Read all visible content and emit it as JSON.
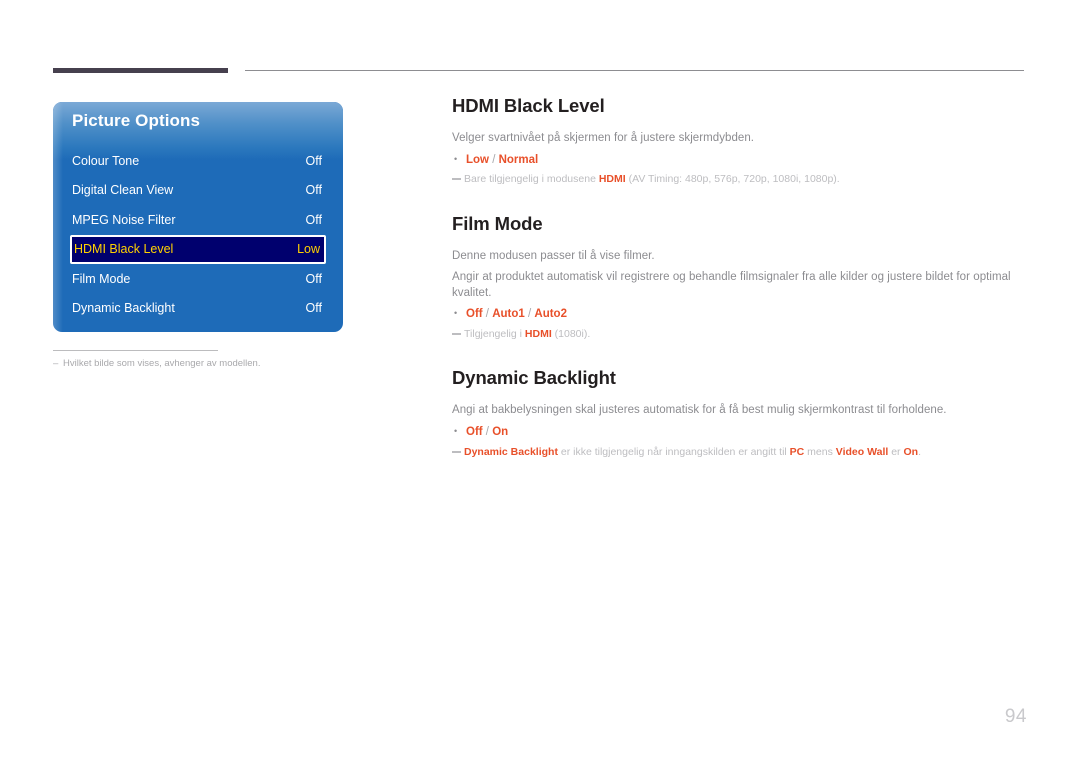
{
  "page": {
    "number": "94",
    "figure_note": "Hvilket bilde som vises, avhenger av modellen.",
    "figure_note_dash": "–"
  },
  "osd": {
    "title": "Picture Options",
    "rows": [
      {
        "label": "Colour Tone",
        "value": "Off",
        "selected": false
      },
      {
        "label": "Digital Clean View",
        "value": "Off",
        "selected": false
      },
      {
        "label": "MPEG Noise Filter",
        "value": "Off",
        "selected": false
      },
      {
        "label": "HDMI Black Level",
        "value": "Low",
        "selected": true
      },
      {
        "label": "Film Mode",
        "value": "Off",
        "selected": false
      },
      {
        "label": "Dynamic Backlight",
        "value": "Off",
        "selected": false
      }
    ],
    "colors": {
      "panel_blue": "#1e6bb8",
      "selected_bg": "#00006e",
      "selected_text": "#ffd200"
    }
  },
  "sections": {
    "hdmi_black_level": {
      "heading": "HDMI Black Level",
      "paragraph": "Velger svartnivået på skjermen for å justere skjermdybden.",
      "options": {
        "a": "Low",
        "sep1": " / ",
        "b": "Normal"
      },
      "note": {
        "pre": "Bare tilgjengelig i modusene ",
        "hl": "HDMI",
        "post": " (AV Timing: 480p, 576p, 720p, 1080i, 1080p)."
      }
    },
    "film_mode": {
      "heading": "Film Mode",
      "paragraph1": "Denne modusen passer til å vise filmer.",
      "paragraph2": "Angir at produktet automatisk vil registrere og behandle filmsignaler fra alle kilder og justere bildet for optimal kvalitet.",
      "options": {
        "a": "Off",
        "sep1": " / ",
        "b": "Auto1",
        "sep2": " / ",
        "c": "Auto2"
      },
      "note": {
        "pre": "Tilgjengelig i ",
        "hl": "HDMI",
        "post": " (1080i)."
      }
    },
    "dynamic_backlight": {
      "heading": "Dynamic Backlight",
      "paragraph": "Angi at bakbelysningen skal justeres automatisk for å få best mulig skjermkontrast til forholdene.",
      "options": {
        "a": "Off",
        "sep1": " / ",
        "b": "On"
      },
      "note": {
        "hl1": "Dynamic Backlight",
        "mid1": " er ikke tilgjengelig når inngangskilden er angitt til ",
        "hl2": "PC",
        "mid2": " mens ",
        "hl3": "Video Wall",
        "mid3": " er ",
        "hl4": "On",
        "end": "."
      }
    }
  }
}
